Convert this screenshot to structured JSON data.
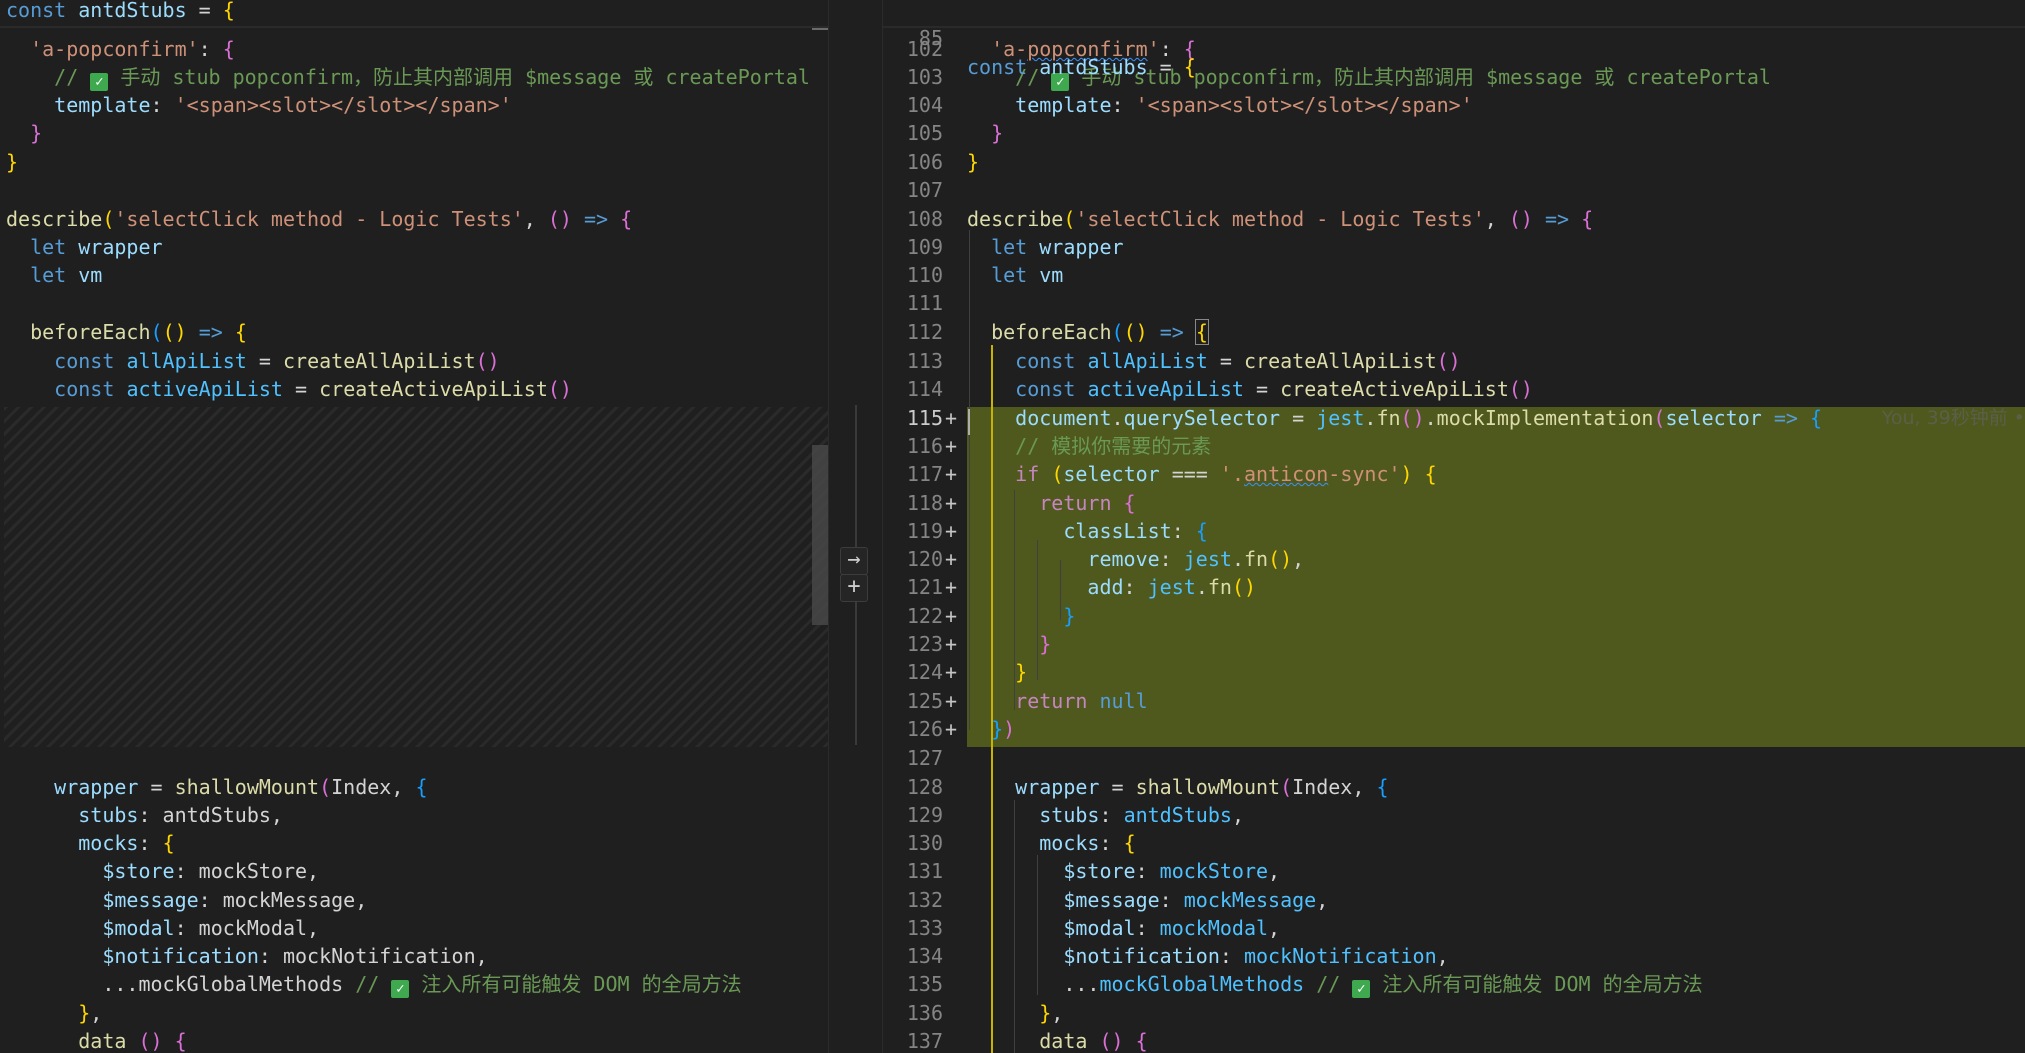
{
  "editor": {
    "sticky": {
      "ln": "85",
      "kw": "const",
      "name": "antdStubs",
      "rest": " = ",
      "brace": "{"
    },
    "blame": "You, 39秒钟前 •",
    "buttons": {
      "apply": "→",
      "add": "+"
    },
    "comments": {
      "popconfirm": "// ✅ 手动 stub popconfirm，防止其内部调用 $message 或 createPortal",
      "mock_hint": "// 模拟你需要的元素",
      "inject": "// ✅ 注入所有可能触发 DOM 的全局方法"
    },
    "line_numbers": [
      "102",
      "103",
      "104",
      "105",
      "106",
      "107",
      "108",
      "109",
      "110",
      "111",
      "112",
      "113",
      "114",
      "115",
      "116",
      "117",
      "118",
      "119",
      "120",
      "121",
      "122",
      "123",
      "124",
      "125",
      "126",
      "127",
      "128",
      "129",
      "130",
      "131",
      "132",
      "133",
      "134",
      "135",
      "136",
      "137"
    ],
    "added_lines": [
      "115",
      "116",
      "117",
      "118",
      "119",
      "120",
      "121",
      "122",
      "123",
      "124",
      "125",
      "126"
    ]
  }
}
